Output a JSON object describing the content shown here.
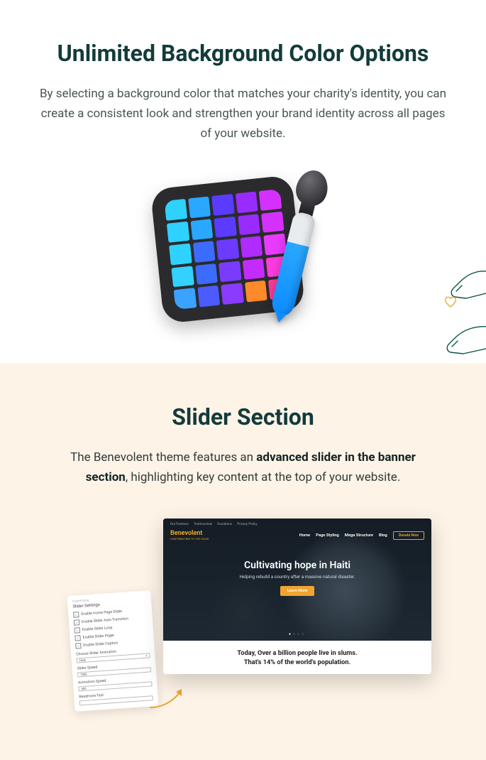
{
  "section1": {
    "title": "Unlimited Background Color Options",
    "description": "By selecting a background color that matches your charity's identity, you can create a consistent look and strengthen your brand identity across all pages of your website.",
    "swatches": [
      "#2fd1ff",
      "#2aa8ff",
      "#5a3bff",
      "#9a2bff",
      "#d431ff",
      "#2fd1ff",
      "#2aa8ff",
      "#5a3bff",
      "#9a2bff",
      "#d431ff",
      "#2fd1ff",
      "#3b6bff",
      "#6b3bff",
      "#b02bff",
      "#e83bff",
      "#32d1ff",
      "#3b6bff",
      "#7b3bff",
      "#c42bff",
      "#ff3be0",
      "#39a3ff",
      "#4b5bff",
      "#8b3bff",
      "#ff8a2b",
      "#ff3b9a"
    ]
  },
  "section2": {
    "title": "Slider Section",
    "desc_pre": "The Benevolent theme features an ",
    "desc_bold": "advanced slider in the banner section",
    "desc_post": ", highlighting key content at the top of your website.",
    "panel": {
      "crumb": "Customizing",
      "title": "Slider Settings",
      "checks": [
        "Enable Home Page Slider",
        "Enable Slider Auto Transition",
        "Enable Slider Loop",
        "Enable Slider Pager",
        "Enable Slider Caption"
      ],
      "anim_label": "Choose Slider Animation",
      "anim_value": "Fade",
      "speed_label": "Slider Speed",
      "speed_value": "7000",
      "aspeed_label": "Animation Speed",
      "aspeed_value": "600",
      "readmore_label": "Readmore Text"
    },
    "mock": {
      "topbar": [
        "Our Partners",
        "Testimonials",
        "Donations",
        "Privacy Policy"
      ],
      "logo_main": "Benevolent",
      "logo_sub": "CONTRIBUTING TO THE GOOD",
      "nav": [
        "Home",
        "Page Styling",
        "Mega Structure",
        "Blog"
      ],
      "donate": "Donate Now",
      "hero_title": "Cultivating hope in Haiti",
      "hero_sub": "Helping rebuild a country after a massive natural disaster.",
      "hero_btn": "Learn More",
      "sub1": "Today, Over a billion people live in slums.",
      "sub2": "That's 14% of the world's population."
    }
  }
}
